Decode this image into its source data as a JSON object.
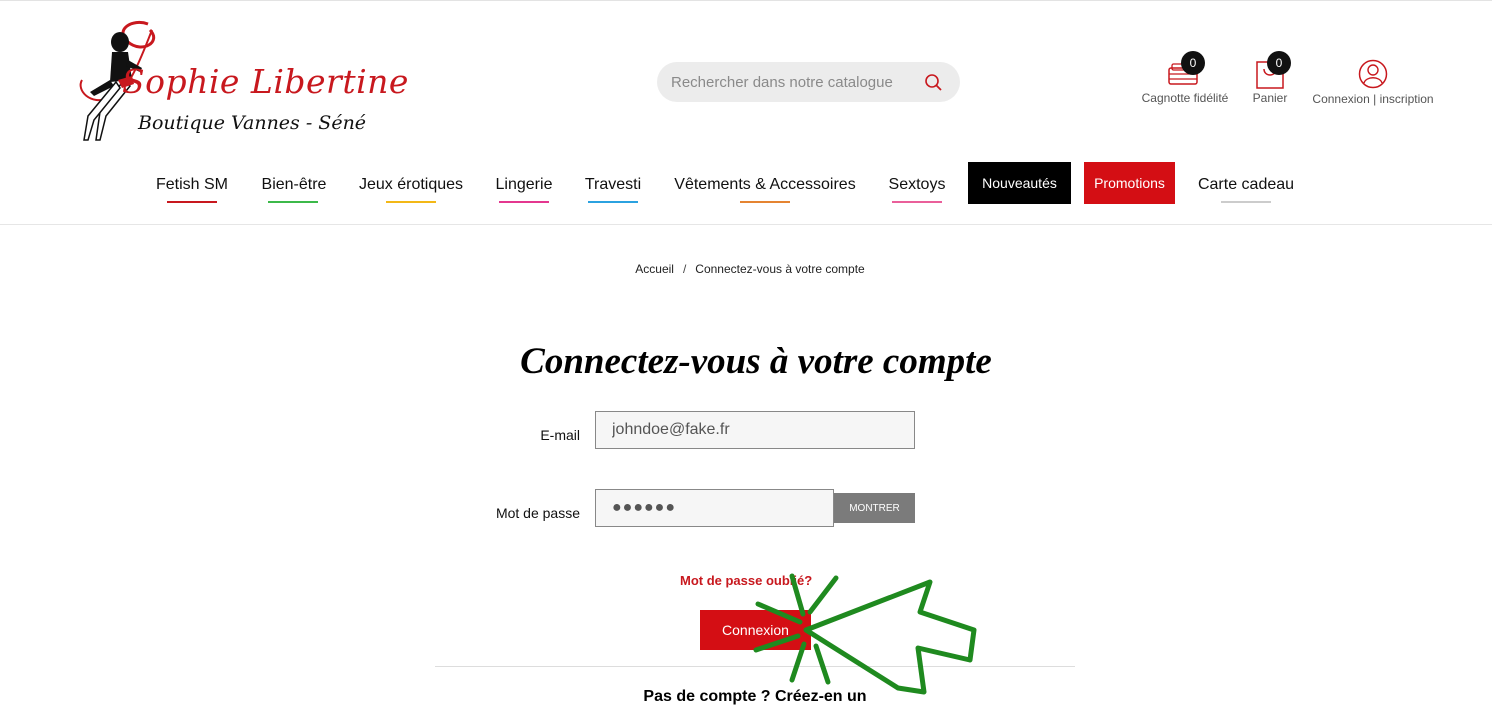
{
  "brand": {
    "name_line1": "Sophie Libertine",
    "name_line2": "Boutique Vannes - Séné"
  },
  "search": {
    "placeholder": "Rechercher dans notre catalogue",
    "icon": "search-icon"
  },
  "header": {
    "loyalty": {
      "label": "Cagnotte fidélité",
      "count": "0",
      "icon": "wallet-icon"
    },
    "cart": {
      "label": "Panier",
      "count": "0",
      "icon": "cart-icon"
    },
    "account": {
      "label": "Connexion | inscription",
      "icon": "user-icon"
    }
  },
  "nav": {
    "fetish": "Fetish SM",
    "bienetre": "Bien-être",
    "jeux": "Jeux érotiques",
    "lingerie": "Lingerie",
    "travesti": "Travesti",
    "vetements": "Vêtements & Accessoires",
    "sextoys": "Sextoys",
    "nouveautes": "Nouveautés",
    "promotions": "Promotions",
    "carte": "Carte cadeau"
  },
  "colors": {
    "brand_red": "#c8181e",
    "button_red": "#d40e14",
    "fetish": "#c8181e",
    "bienetre": "#3cb94a",
    "jeux": "#f3b817",
    "lingerie": "#e4378f",
    "travesti": "#2ba2e0",
    "vetements": "#e58431",
    "sextoys": "#ea5f9a",
    "carte": "#cccccc",
    "cursor_green": "#1f8a1f"
  },
  "breadcrumb": {
    "home": "Accueil",
    "separator": "/",
    "current": "Connectez-vous à votre compte"
  },
  "page": {
    "title": "Connectez-vous à votre compte"
  },
  "form": {
    "email_label": "E-mail",
    "email_value": "johndoe@fake.fr",
    "password_label": "Mot de passe",
    "password_value": "●●●●●●",
    "show_label": "MONTRER",
    "forgot_label": "Mot de passe oublié?",
    "submit_label": "Connexion",
    "no_account_label": "Pas de compte ? Créez-en un"
  }
}
